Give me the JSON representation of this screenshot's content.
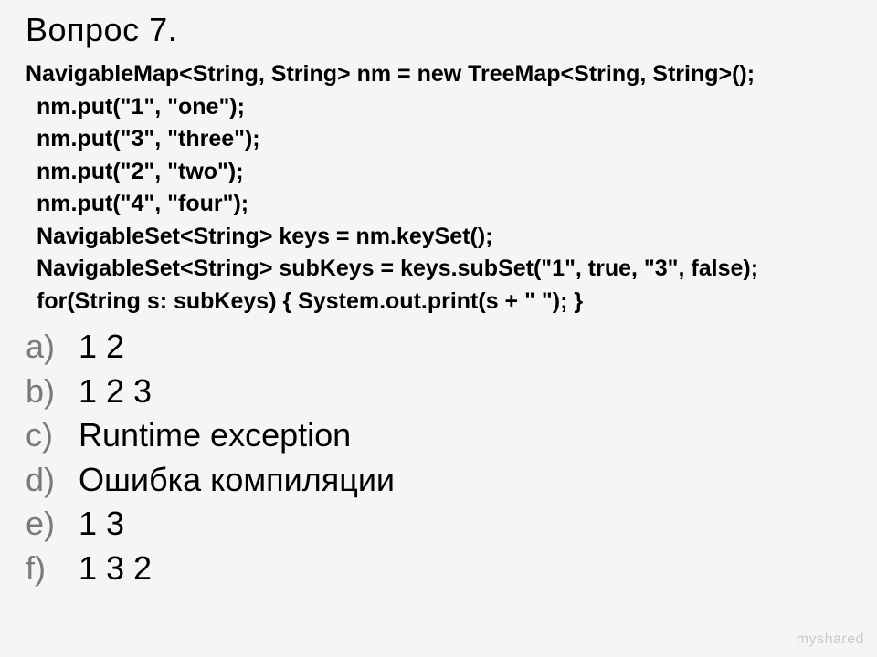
{
  "title": "Вопрос 7.",
  "code": [
    {
      "text": "NavigableMap<String, String> nm = new TreeMap<String, String>();",
      "indent": false
    },
    {
      "text": "nm.put(\"1\", \"one\");",
      "indent": true
    },
    {
      "text": "nm.put(\"3\", \"three\");",
      "indent": true
    },
    {
      "text": "nm.put(\"2\", \"two\");",
      "indent": true
    },
    {
      "text": "nm.put(\"4\", \"four\");",
      "indent": true
    },
    {
      "text": "NavigableSet<String> keys = nm.keySet();",
      "indent": true
    },
    {
      "text": "NavigableSet<String> subKeys = keys.subSet(\"1\", true, \"3\", false);",
      "indent": true
    },
    {
      "text": "for(String s: subKeys) { System.out.print(s + \" \"); }",
      "indent": true
    }
  ],
  "options": [
    {
      "letter": "a)",
      "text": "1 2"
    },
    {
      "letter": "b)",
      "text": "1 2 3"
    },
    {
      "letter": "c)",
      "text": "Runtime exception"
    },
    {
      "letter": "d)",
      "text": "Ошибка компиляции"
    },
    {
      "letter": "e)",
      "text": "1 3"
    },
    {
      "letter": "f)",
      "text": "1 3 2"
    }
  ],
  "watermark": "myshared"
}
